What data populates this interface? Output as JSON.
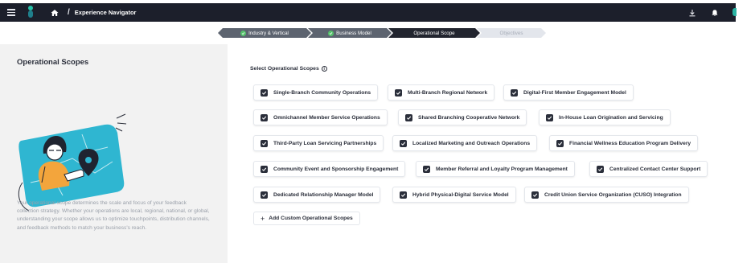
{
  "topbar": {
    "title": "Experience Navigator",
    "separator": "/",
    "icons": [
      "menu-icon",
      "logo",
      "home-icon",
      "download-icon",
      "bell-icon"
    ]
  },
  "stepper": {
    "steps": [
      {
        "label": "Industry & Vertical",
        "state": "done"
      },
      {
        "label": "Business Model",
        "state": "done"
      },
      {
        "label": "Operational Scope",
        "state": "active"
      },
      {
        "label": "Objectives",
        "state": "todo"
      }
    ]
  },
  "left": {
    "title": "Operational Scopes",
    "description": "Your operational scope determines the scale and focus of your feedback collection strategy. Whether your operations are local, regional, national, or global, understanding your scope allows us to optimize touchpoints, distribution channels, and feedback methods to match your business's reach."
  },
  "main": {
    "section_title": "Select Operational Scopes",
    "scopes": [
      {
        "label": "Single-Branch Community Operations",
        "checked": true
      },
      {
        "label": "Multi-Branch Regional Network",
        "checked": true
      },
      {
        "label": "Digital-First Member Engagement Model",
        "checked": true
      },
      {
        "label": "Omnichannel Member Service Operations",
        "checked": true
      },
      {
        "label": "Shared Branching Cooperative Network",
        "checked": true
      },
      {
        "label": "In-House Loan Origination and Servicing",
        "checked": true
      },
      {
        "label": "Third-Party Loan Servicing Partnerships",
        "checked": true
      },
      {
        "label": "Localized Marketing and Outreach Operations",
        "checked": true
      },
      {
        "label": "Financial Wellness Education Program Delivery",
        "checked": true
      },
      {
        "label": "Community Event and Sponsorship Engagement",
        "checked": true
      },
      {
        "label": "Member Referral and Loyalty Program Management",
        "checked": true
      },
      {
        "label": "Centralized Contact Center Support",
        "checked": true
      },
      {
        "label": "Dedicated Relationship Manager Model",
        "checked": true
      },
      {
        "label": "Hybrid Physical-Digital Service Model",
        "checked": true
      },
      {
        "label": "Credit Union Service Organization (CUSO) Integration",
        "checked": true
      }
    ],
    "add_button": "Add Custom Operational Scopes"
  },
  "colors": {
    "topbar": "#1c1f2b",
    "accent": "#2bb3a3",
    "checkbox": "#2a2e3a",
    "step_done": "#5d6470",
    "step_active": "#22252f",
    "step_check": "#55c26b"
  }
}
